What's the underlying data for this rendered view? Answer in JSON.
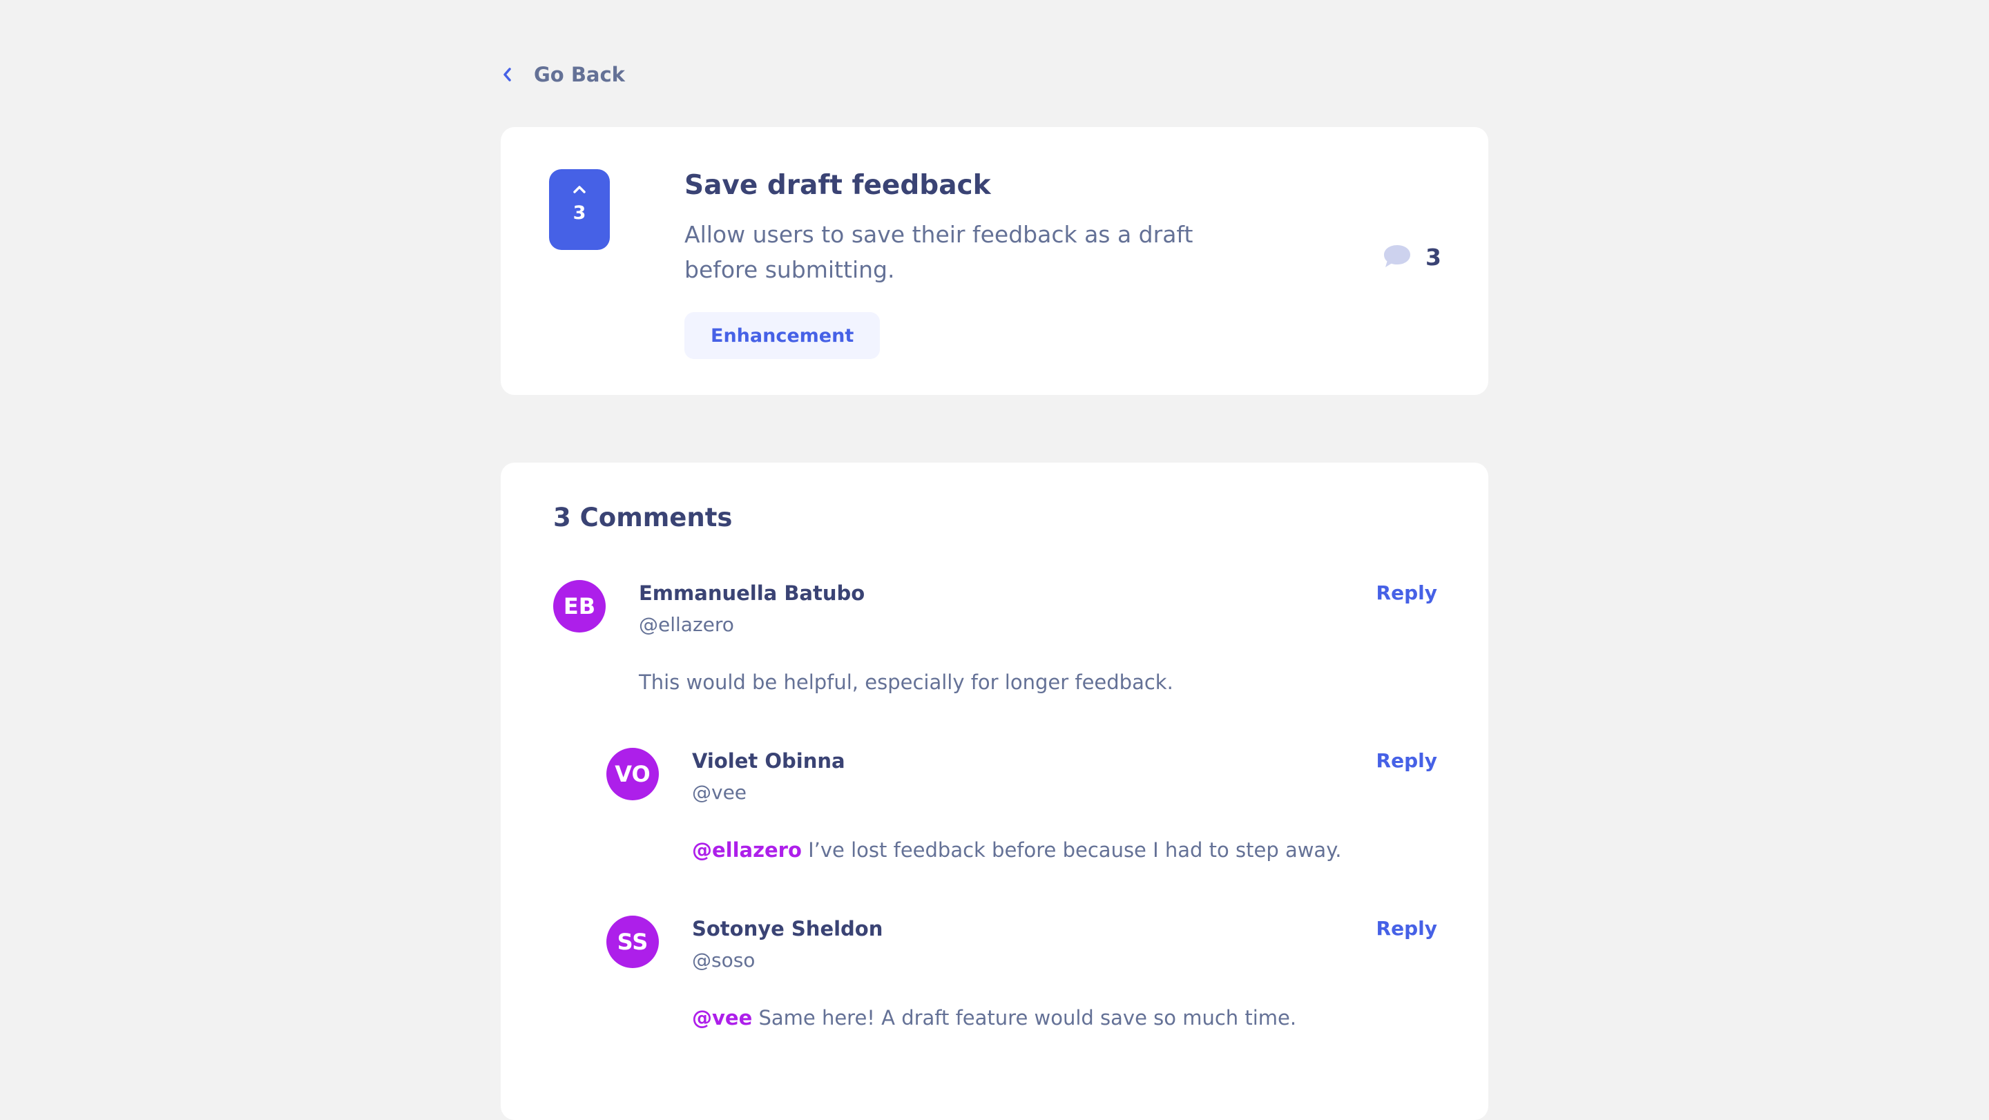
{
  "nav": {
    "go_back_label": "Go Back"
  },
  "feedback": {
    "upvotes": "3",
    "title": "Save draft feedback",
    "description": "Allow users to save their feedback as a draft before submitting.",
    "category": "Enhancement",
    "comment_count": "3"
  },
  "comments_section": {
    "title": "3 Comments",
    "reply_label": "Reply",
    "comments": [
      {
        "initials": "EB",
        "name": "Emmanuella Batubo",
        "handle": "@ellazero",
        "mention": "",
        "text": "This would be helpful, especially for longer feedback."
      },
      {
        "initials": "VO",
        "name": "Violet Obinna",
        "handle": "@vee",
        "mention": "@ellazero",
        "text": "I’ve lost feedback before because I had to step away."
      },
      {
        "initials": "SS",
        "name": "Sotonye Sheldon",
        "handle": "@soso",
        "mention": "@vee",
        "text": "Same here! A draft feature would save so much time."
      }
    ]
  },
  "colors": {
    "background": "#f2f2f2",
    "card": "#ffffff",
    "primary_blue": "#4661e6",
    "purple": "#ad1fea",
    "dark_text": "#3a4374",
    "muted_text": "#647196",
    "tag_bg": "#f2f4ff",
    "bubble": "#cdd2ee"
  },
  "icons": {
    "back": "chevron-left-icon",
    "upvote": "chevron-up-icon",
    "comments": "speech-bubble-icon"
  }
}
